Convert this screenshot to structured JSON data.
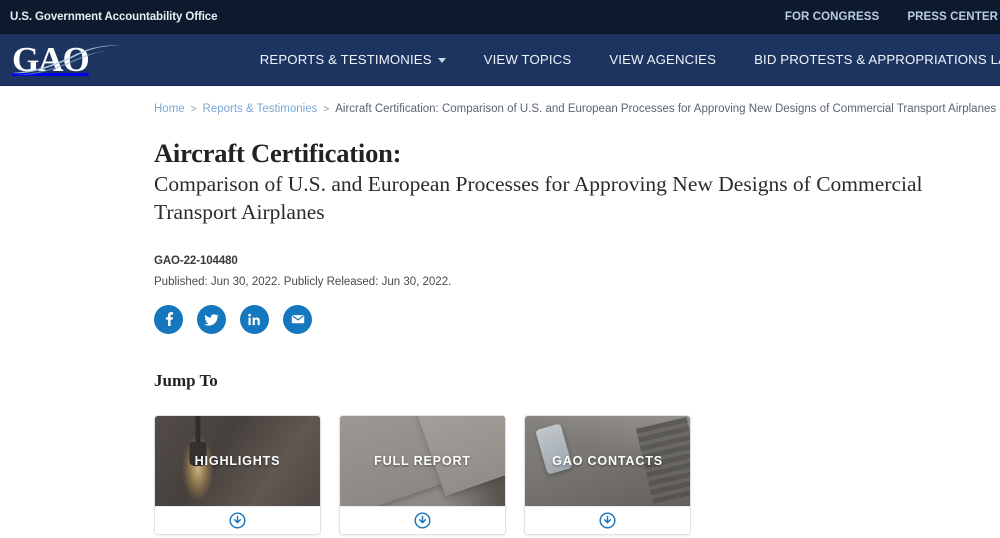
{
  "utility_bar": {
    "agency_name": "U.S. Government Accountability Office",
    "links": [
      {
        "label": "FOR CONGRESS",
        "name": "for-congress"
      },
      {
        "label": "PRESS CENTER",
        "name": "press-center"
      }
    ]
  },
  "header": {
    "logo_text": "GAO",
    "nav_items": [
      {
        "label": "REPORTS & TESTIMONIES",
        "has_caret": true
      },
      {
        "label": "VIEW TOPICS",
        "has_caret": false
      },
      {
        "label": "VIEW AGENCIES",
        "has_caret": false
      },
      {
        "label": "BID PROTESTS & APPROPRIATIONS LAW",
        "has_caret": true
      }
    ]
  },
  "breadcrumb": {
    "home": "Home",
    "sep1": ">",
    "section": "Reports & Testimonies",
    "sep2": ">",
    "current": "Aircraft Certification: Comparison of U.S. and European Processes for Approving New Designs of Commercial Transport Airplanes"
  },
  "report": {
    "title_main": "Aircraft Certification:",
    "title_sub": "Comparison of U.S. and European Processes for Approving New Designs of Commercial Transport Airplanes",
    "report_number": "GAO-22-104480",
    "publication_line": "Published: Jun 30, 2022. Publicly Released: Jun 30, 2022."
  },
  "social": [
    {
      "name": "facebook-share-icon",
      "label": "Facebook"
    },
    {
      "name": "twitter-share-icon",
      "label": "Twitter"
    },
    {
      "name": "linkedin-share-icon",
      "label": "LinkedIn"
    },
    {
      "name": "email-share-icon",
      "label": "Email"
    }
  ],
  "jump_to": {
    "heading": "Jump To",
    "cards": [
      {
        "label": "HIGHLIGHTS",
        "image": "lightbulb-photo",
        "download_icon": "download-circle-icon"
      },
      {
        "label": "FULL REPORT",
        "image": "gao-report-covers-photo",
        "download_icon": "download-circle-icon"
      },
      {
        "label": "GAO CONTACTS",
        "image": "hands-phone-laptop-photo",
        "download_icon": "download-circle-icon"
      }
    ]
  },
  "colors": {
    "utility_bar_bg": "#0d1a2d",
    "nav_bg": "#1d3461",
    "accent_blue": "#1577bd",
    "link_blue": "#7ba7d7"
  }
}
